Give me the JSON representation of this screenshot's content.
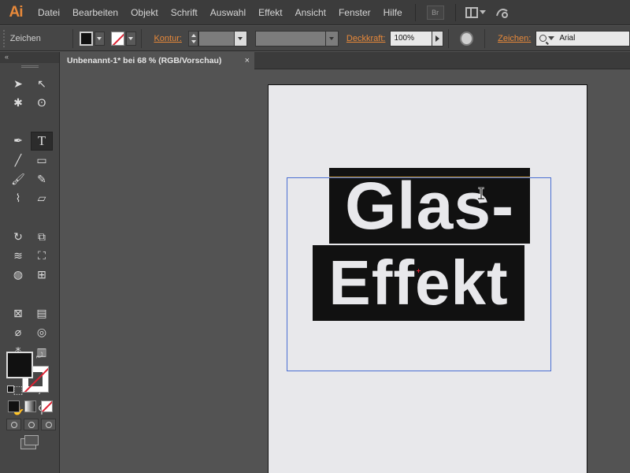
{
  "app": {
    "logo": "Ai"
  },
  "menu": {
    "items": [
      "Datei",
      "Bearbeiten",
      "Objekt",
      "Schrift",
      "Auswahl",
      "Effekt",
      "Ansicht",
      "Fenster",
      "Hilfe"
    ],
    "bridge_label": "Br"
  },
  "control": {
    "context_label": "Zeichen",
    "stroke_link": "Kontur:",
    "opacity_link": "Deckkraft:",
    "opacity_value": "100%",
    "font_link": "Zeichen:",
    "font_value": "Arial"
  },
  "document": {
    "tab_title": "Unbenannt-1* bei 68 % (RGB/Vorschau)",
    "close_glyph": "×"
  },
  "artwork": {
    "line1": "Glas-",
    "line2": "Effekt"
  },
  "colors": {
    "accent": "#e8893a",
    "fill": "#111111",
    "stroke_none": "#dd2233",
    "selection": "#4a6fd2",
    "ui_bg": "#535353"
  },
  "tools": [
    "selection-tool",
    "direct-selection-tool",
    "magic-wand-tool",
    "lasso-tool",
    "pen-tool",
    "type-tool",
    "line-tool",
    "rectangle-tool",
    "paintbrush-tool",
    "pencil-tool",
    "blob-brush-tool",
    "eraser-tool",
    "rotate-tool",
    "scale-tool",
    "width-tool",
    "free-transform-tool",
    "shape-builder-tool",
    "perspective-grid-tool",
    "mesh-tool",
    "gradient-tool",
    "eyedropper-tool",
    "blend-tool",
    "symbol-sprayer-tool",
    "column-graph-tool",
    "artboard-tool",
    "slice-tool",
    "hand-tool",
    "zoom-tool"
  ]
}
